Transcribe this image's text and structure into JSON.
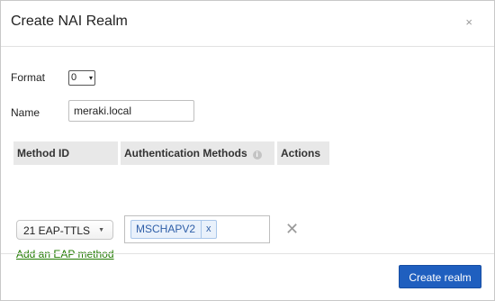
{
  "dialog": {
    "title": "Create NAI Realm",
    "close_glyph": "×"
  },
  "form": {
    "format_label": "Format",
    "format_value": "0",
    "format_caret": "▾",
    "name_label": "Name",
    "name_value": "meraki.local"
  },
  "table": {
    "headers": [
      "Method ID",
      "Authentication Methods",
      "Actions"
    ],
    "info_glyph": "i",
    "rows": [
      {
        "method": "21 EAP-TTLS",
        "method_caret": "▼",
        "auth_methods": [
          "MSCHAPV2"
        ],
        "tag_remove": "x",
        "row_remove": "✕"
      }
    ],
    "add_link": "Add an EAP method"
  },
  "footer": {
    "submit_label": "Create realm"
  },
  "colors": {
    "primary": "#1f5fbf",
    "link": "#217a00",
    "tag_bg": "#e9f1fb",
    "tag_text": "#2f5fa8"
  }
}
